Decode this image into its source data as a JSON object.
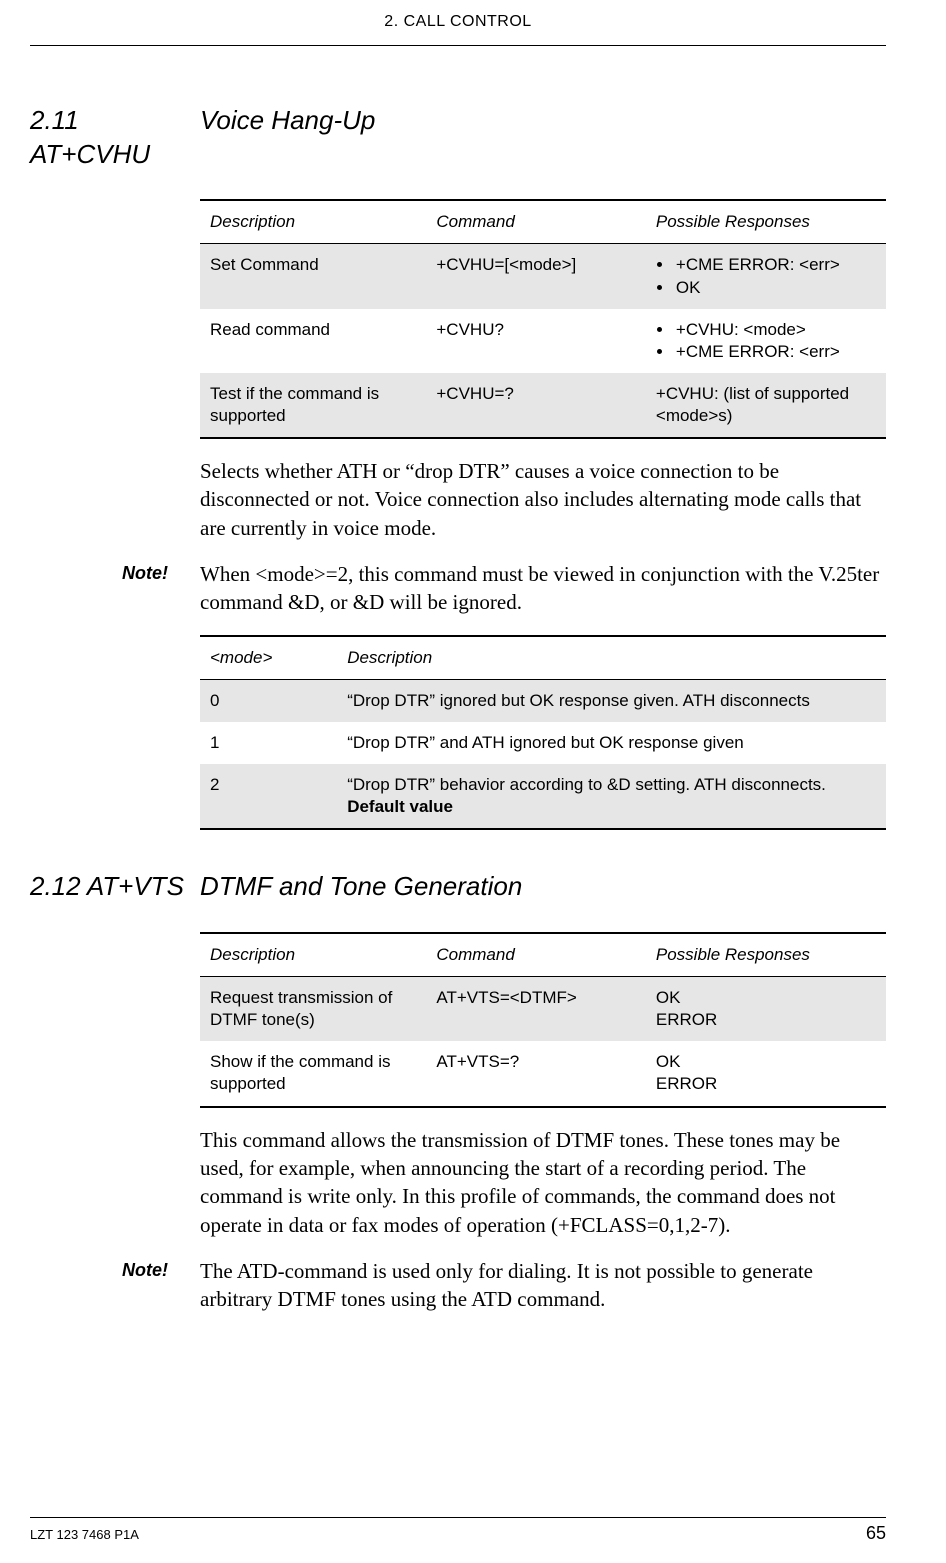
{
  "header": {
    "chapter": "2. CALL CONTROL"
  },
  "sections": {
    "s211": {
      "num": "2.11 AT+CVHU",
      "title": "Voice Hang-Up",
      "table1": {
        "headers": [
          "Description",
          "Command",
          "Possible Responses"
        ],
        "rows": [
          {
            "desc": "Set Command",
            "cmd": "+CVHU=[<mode>]",
            "resp": [
              "+CME ERROR: <err>",
              "OK"
            ]
          },
          {
            "desc": "Read command",
            "cmd": "+CVHU?",
            "resp": [
              "+CVHU: <mode>",
              "+CME ERROR: <err>"
            ]
          },
          {
            "desc": "Test if the command is supported",
            "cmd": "+CVHU=?",
            "resp_plain": "+CVHU: (list of supported <mode>s)"
          }
        ]
      },
      "body1": "Selects whether ATH or “drop DTR” causes a voice connection to be disconnected or not. Voice connection also includes alternating mode calls that are currently in voice mode.",
      "note_label": "Note!",
      "note_body": "When <mode>=2, this command must be viewed in conjunction with the V.25ter command &D, or &D will be ignored.",
      "table2": {
        "headers": [
          "<mode>",
          "Description"
        ],
        "rows": [
          {
            "mode": "0",
            "desc": "“Drop DTR” ignored but OK response given. ATH disconnects"
          },
          {
            "mode": "1",
            "desc": "“Drop DTR” and ATH ignored but OK response given"
          },
          {
            "mode": "2",
            "desc_pre": "“Drop DTR” behavior according to &D setting. ATH disconnects. ",
            "desc_bold": "Default value"
          }
        ]
      }
    },
    "s212": {
      "num": "2.12 AT+VTS",
      "title": "DTMF and Tone Generation",
      "table1": {
        "headers": [
          "Description",
          "Command",
          "Possible Responses"
        ],
        "rows": [
          {
            "desc": "Request transmission of DTMF tone(s)",
            "cmd": "AT+VTS=<DTMF>",
            "resp_lines": "OK\nERROR"
          },
          {
            "desc": "Show if the command is supported",
            "cmd": "AT+VTS=?",
            "resp_lines": "OK\nERROR"
          }
        ]
      },
      "body1": "This command allows the transmission of DTMF tones. These tones may be used, for example, when announcing the start of a recording period. The command is write only. In this profile of commands, the command does not operate in data or fax modes of operation (+FCLASS=0,1,2-7).",
      "note_label": "Note!",
      "note_body": "The ATD-command is used only for dialing. It is not possible to generate arbitrary DTMF tones using the ATD command."
    }
  },
  "footer": {
    "doc_id": "LZT 123 7468 P1A",
    "page": "65"
  }
}
